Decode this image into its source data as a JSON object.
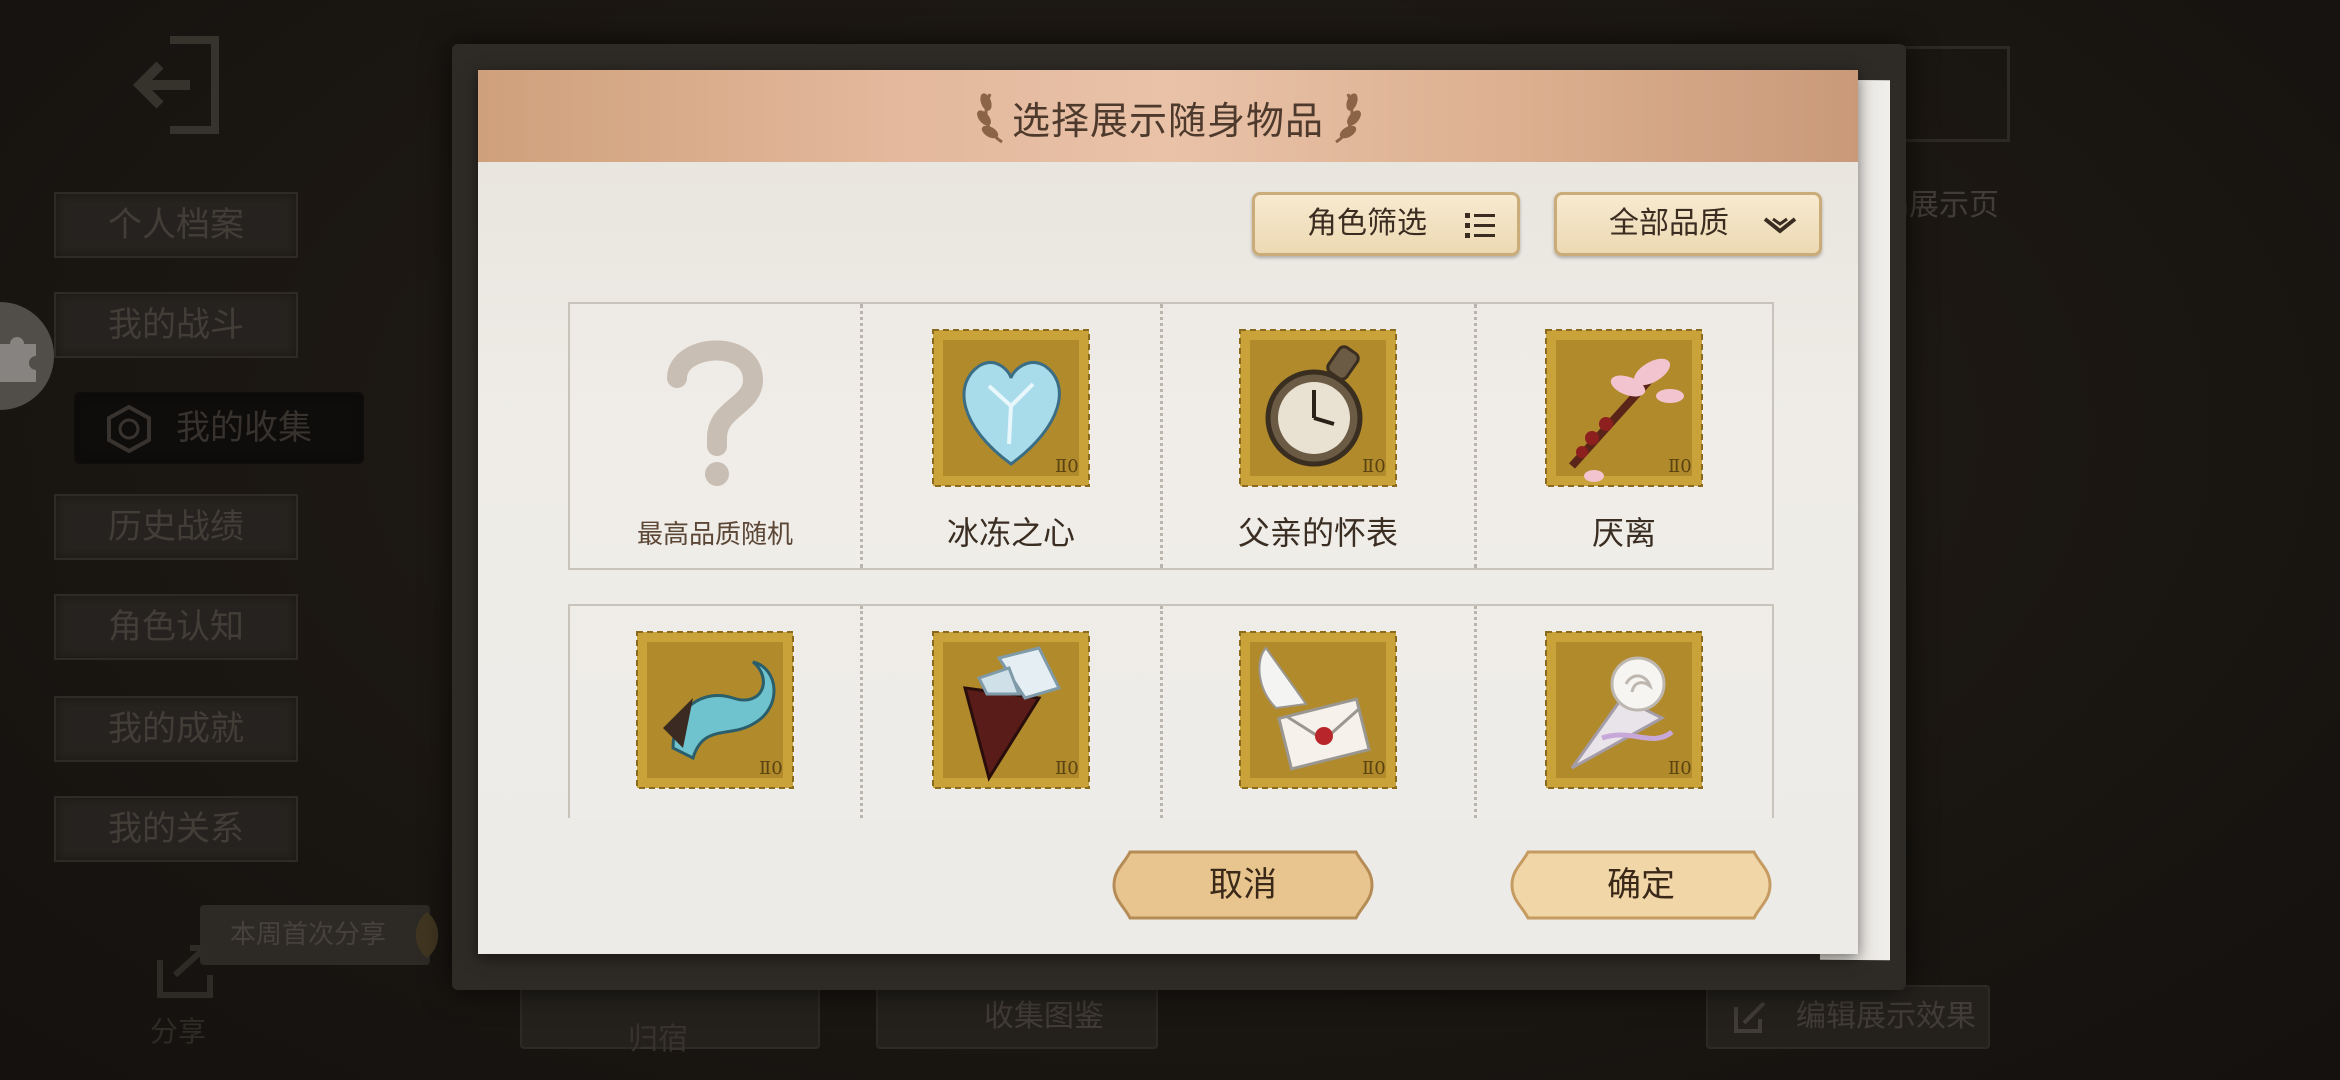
{
  "background": {
    "sidebar_items": [
      {
        "label": "个人档案"
      },
      {
        "label": "我的战斗"
      },
      {
        "label": "我的收集"
      },
      {
        "label": "历史战绩"
      },
      {
        "label": "角色认知"
      },
      {
        "label": "我的成就"
      },
      {
        "label": "我的关系"
      }
    ],
    "share_badge": "本周首次分享",
    "share_label": "分享",
    "guisu_label": "归宿",
    "collection_label": "收集图鉴",
    "edit_effect_label": "编辑展示效果",
    "right_text": "n展示页"
  },
  "modal": {
    "title": "选择展示随身物品",
    "role_filter_label": "角色筛选",
    "quality_filter_label": "全部品质",
    "items_row1": [
      {
        "name": "最高品质随机",
        "icon": "question-mark-icon"
      },
      {
        "name": "冰冻之心",
        "icon": "frozen-heart-stamp"
      },
      {
        "name": "父亲的怀表",
        "icon": "pocket-watch-stamp"
      },
      {
        "name": "厌离",
        "icon": "cherry-branch-stamp"
      }
    ],
    "items_row2": [
      {
        "icon": "blue-dragon-stamp"
      },
      {
        "icon": "crystal-cone-stamp"
      },
      {
        "icon": "winged-letter-stamp"
      },
      {
        "icon": "white-rose-bouquet-stamp"
      }
    ],
    "cancel_label": "取消",
    "confirm_label": "确定"
  },
  "colors": {
    "header_accent": "#e3b89c",
    "stamp_gold": "#c9a23a",
    "button_tan": "#e8c58e"
  }
}
